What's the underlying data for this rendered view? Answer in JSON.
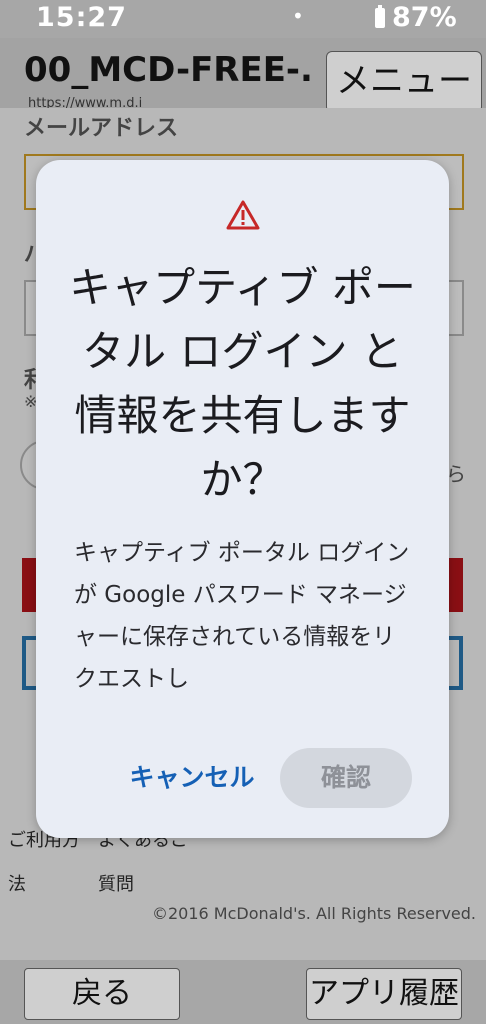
{
  "status_bar": {
    "time": "15:27",
    "dot": "•",
    "battery": "87%"
  },
  "header": {
    "title": "00_MCD-FREE-...",
    "subtitle": "https://www.m.d.i",
    "menu_label": "メニュー"
  },
  "page": {
    "email_label": "メールアドレス",
    "password_label_partial": "パ",
    "terms_label_partial": "利",
    "note_partial": "※",
    "side_char": "ら",
    "footer_link_1a": "ご利用方",
    "footer_link_1b": "法",
    "footer_link_2a": "よくあるご",
    "footer_link_2b": "質問",
    "copyright": "©2016 McDonald's. All Rights Reserved."
  },
  "dialog": {
    "title": "キャプティブ ポータル ログイン と情報を共有しますか？",
    "body": "キャプティブ ポータル ログイン が Google パスワード マネージャーに保存されている情報をリクエストし",
    "cancel_label": "キャンセル",
    "confirm_label": "確認",
    "colors": {
      "accent": "#1560b5",
      "warning": "#c62828"
    }
  },
  "bottom_bar": {
    "back_label": "戻る",
    "history_label": "アプリ履歴"
  }
}
